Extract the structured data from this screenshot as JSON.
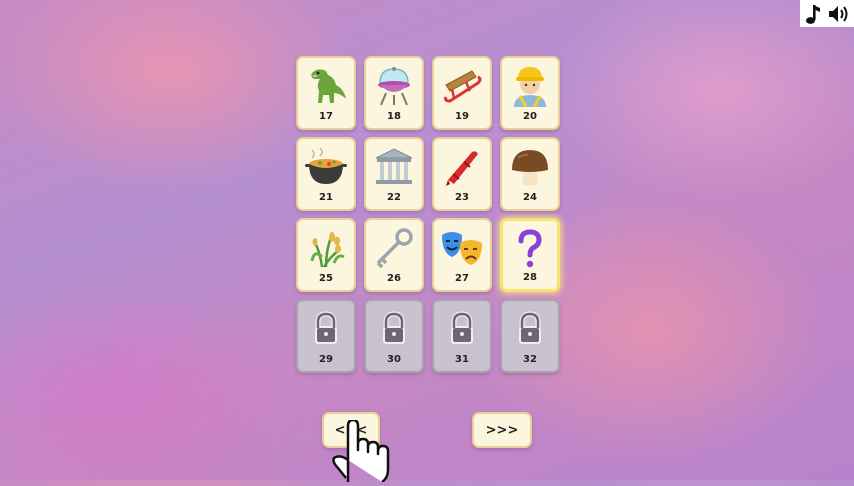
{
  "audio": {
    "music_icon": "music-note-icon",
    "sound_icon": "speaker-icon"
  },
  "levels": [
    {
      "number": "17",
      "icon": "dinosaur",
      "state": "unlocked"
    },
    {
      "number": "18",
      "icon": "grill",
      "state": "unlocked"
    },
    {
      "number": "19",
      "icon": "sled",
      "state": "unlocked"
    },
    {
      "number": "20",
      "icon": "construction-worker",
      "state": "unlocked"
    },
    {
      "number": "21",
      "icon": "stew-pot",
      "state": "unlocked"
    },
    {
      "number": "22",
      "icon": "classical-building",
      "state": "unlocked"
    },
    {
      "number": "23",
      "icon": "crayon",
      "state": "unlocked"
    },
    {
      "number": "24",
      "icon": "mushroom",
      "state": "unlocked"
    },
    {
      "number": "25",
      "icon": "rice-plant",
      "state": "unlocked"
    },
    {
      "number": "26",
      "icon": "old-key",
      "state": "unlocked"
    },
    {
      "number": "27",
      "icon": "theater-masks",
      "state": "unlocked"
    },
    {
      "number": "28",
      "icon": "question-mark",
      "state": "current"
    },
    {
      "number": "29",
      "icon": "lock",
      "state": "locked"
    },
    {
      "number": "30",
      "icon": "lock",
      "state": "locked"
    },
    {
      "number": "31",
      "icon": "lock",
      "state": "locked"
    },
    {
      "number": "32",
      "icon": "lock",
      "state": "locked"
    }
  ],
  "nav": {
    "prev_label": "<<<",
    "next_label": ">>>"
  },
  "colors": {
    "tile": "#fdf6df",
    "tile_border": "#e8cf99",
    "current_border": "#f7e470",
    "locked_tile": "#c9c1cf"
  }
}
